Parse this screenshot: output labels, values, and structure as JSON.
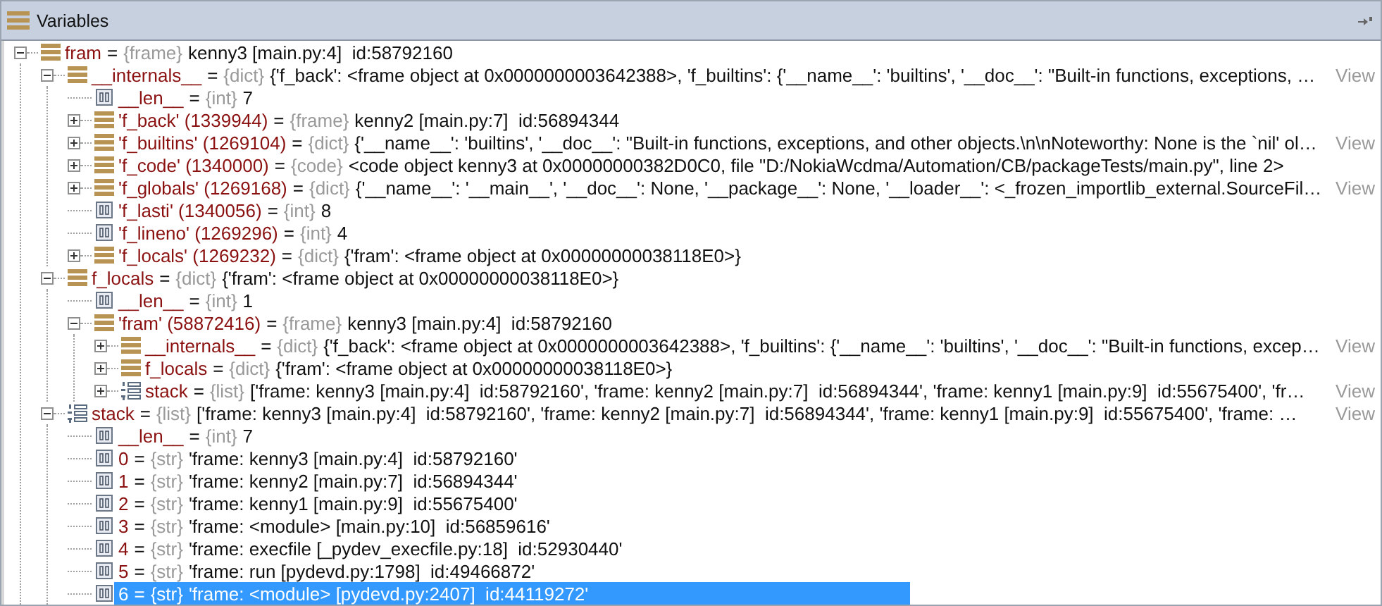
{
  "panel": {
    "title": "Variables"
  },
  "tree": [
    {
      "name": "fram",
      "sep": "=",
      "type": "{frame}",
      "value": "kenny3 [main.py:4]  id:58792160",
      "kind": "object",
      "expanded": true,
      "selected": false,
      "children": [
        {
          "name": "__internals__",
          "sep": "=",
          "type": "{dict}",
          "value": "{'f_back': <frame object at 0x0000000003642388>, 'f_builtins': {'__name__': 'builtins', '__doc__': \"Built-in functions, exceptions, …",
          "view": "View",
          "kind": "object",
          "expanded": true,
          "selected": false,
          "children": [
            {
              "name": "__len__",
              "sep": "=",
              "type": "{int}",
              "value": "7",
              "kind": "scalar",
              "selected": false
            },
            {
              "name": "'f_back' (1339944)",
              "sep": "=",
              "type": "{frame}",
              "value": "kenny2 [main.py:7]  id:56894344",
              "kind": "object",
              "expanded": false,
              "selected": false
            },
            {
              "name": "'f_builtins' (1269104)",
              "sep": "=",
              "type": "{dict}",
              "value": "{'__name__': 'builtins', '__doc__': \"Built-in functions, exceptions, and other objects.\\n\\nNoteworthy: None is the `nil' ol…",
              "view": "View",
              "kind": "object",
              "expanded": false,
              "selected": false
            },
            {
              "name": "'f_code' (1340000)",
              "sep": "=",
              "type": "{code}",
              "value": "<code object kenny3 at 0x00000000382D0C0, file \"D:/NokiaWcdma/Automation/CB/packageTests/main.py\", line 2>",
              "kind": "object",
              "expanded": false,
              "selected": false
            },
            {
              "name": "'f_globals' (1269168)",
              "sep": "=",
              "type": "{dict}",
              "value": "{'__name__': '__main__', '__doc__': None, '__package__': None, '__loader__': <_frozen_importlib_external.SourceFil…",
              "view": "View",
              "kind": "object",
              "expanded": false,
              "selected": false
            },
            {
              "name": "'f_lasti' (1340056)",
              "sep": "=",
              "type": "{int}",
              "value": "8",
              "kind": "scalar",
              "selected": false
            },
            {
              "name": "'f_lineno' (1269296)",
              "sep": "=",
              "type": "{int}",
              "value": "4",
              "kind": "scalar",
              "selected": false
            },
            {
              "name": "'f_locals' (1269232)",
              "sep": "=",
              "type": "{dict}",
              "value": "{'fram': <frame object at 0x00000000038118E0>}",
              "kind": "object",
              "expanded": false,
              "selected": false
            }
          ]
        },
        {
          "name": "f_locals",
          "sep": "=",
          "type": "{dict}",
          "value": "{'fram': <frame object at 0x00000000038118E0>}",
          "kind": "object",
          "expanded": true,
          "selected": false,
          "children": [
            {
              "name": "__len__",
              "sep": "=",
              "type": "{int}",
              "value": "1",
              "kind": "scalar",
              "selected": false
            },
            {
              "name": "'fram' (58872416)",
              "sep": "=",
              "type": "{frame}",
              "value": "kenny3 [main.py:4]  id:58792160",
              "kind": "object",
              "expanded": true,
              "selected": false,
              "children": [
                {
                  "name": "__internals__",
                  "sep": "=",
                  "type": "{dict}",
                  "value": "{'f_back': <frame object at 0x0000000003642388>, 'f_builtins': {'__name__': 'builtins', '__doc__': \"Built-in functions, excep…",
                  "view": "View",
                  "kind": "object",
                  "expanded": false,
                  "selected": false
                },
                {
                  "name": "f_locals",
                  "sep": "=",
                  "type": "{dict}",
                  "value": "{'fram': <frame object at 0x00000000038118E0>}",
                  "kind": "object",
                  "expanded": false,
                  "selected": false
                },
                {
                  "name": "stack",
                  "sep": "=",
                  "type": "{list}",
                  "value": "['frame: kenny3 [main.py:4]  id:58792160', 'frame: kenny2 [main.py:7]  id:56894344', 'frame: kenny1 [main.py:9]  id:55675400', 'fr…",
                  "view": "View",
                  "kind": "list",
                  "expanded": false,
                  "selected": false
                }
              ]
            }
          ]
        },
        {
          "name": "stack",
          "sep": "=",
          "type": "{list}",
          "value": "['frame: kenny3 [main.py:4]  id:58792160', 'frame: kenny2 [main.py:7]  id:56894344', 'frame: kenny1 [main.py:9]  id:55675400', 'frame: …",
          "view": "View",
          "kind": "list",
          "expanded": true,
          "selected": false,
          "children": [
            {
              "name": "__len__",
              "sep": "=",
              "type": "{int}",
              "value": "7",
              "kind": "scalar",
              "selected": false
            },
            {
              "name": "0",
              "sep": "=",
              "type": "{str}",
              "value": "'frame: kenny3 [main.py:4]  id:58792160'",
              "kind": "scalar",
              "selected": false
            },
            {
              "name": "1",
              "sep": "=",
              "type": "{str}",
              "value": "'frame: kenny2 [main.py:7]  id:56894344'",
              "kind": "scalar",
              "selected": false
            },
            {
              "name": "2",
              "sep": "=",
              "type": "{str}",
              "value": "'frame: kenny1 [main.py:9]  id:55675400'",
              "kind": "scalar",
              "selected": false
            },
            {
              "name": "3",
              "sep": "=",
              "type": "{str}",
              "value": "'frame: <module> [main.py:10]  id:56859616'",
              "kind": "scalar",
              "selected": false
            },
            {
              "name": "4",
              "sep": "=",
              "type": "{str}",
              "value": "'frame: execfile [_pydev_execfile.py:18]  id:52930440'",
              "kind": "scalar",
              "selected": false
            },
            {
              "name": "5",
              "sep": "=",
              "type": "{str}",
              "value": "'frame: run [pydevd.py:1798]  id:49466872'",
              "kind": "scalar",
              "selected": false
            },
            {
              "name": "6",
              "sep": "=",
              "type": "{str}",
              "value": "'frame: <module> [pydevd.py:2407]  id:44119272'",
              "kind": "scalar",
              "selected": true
            }
          ]
        }
      ]
    }
  ]
}
